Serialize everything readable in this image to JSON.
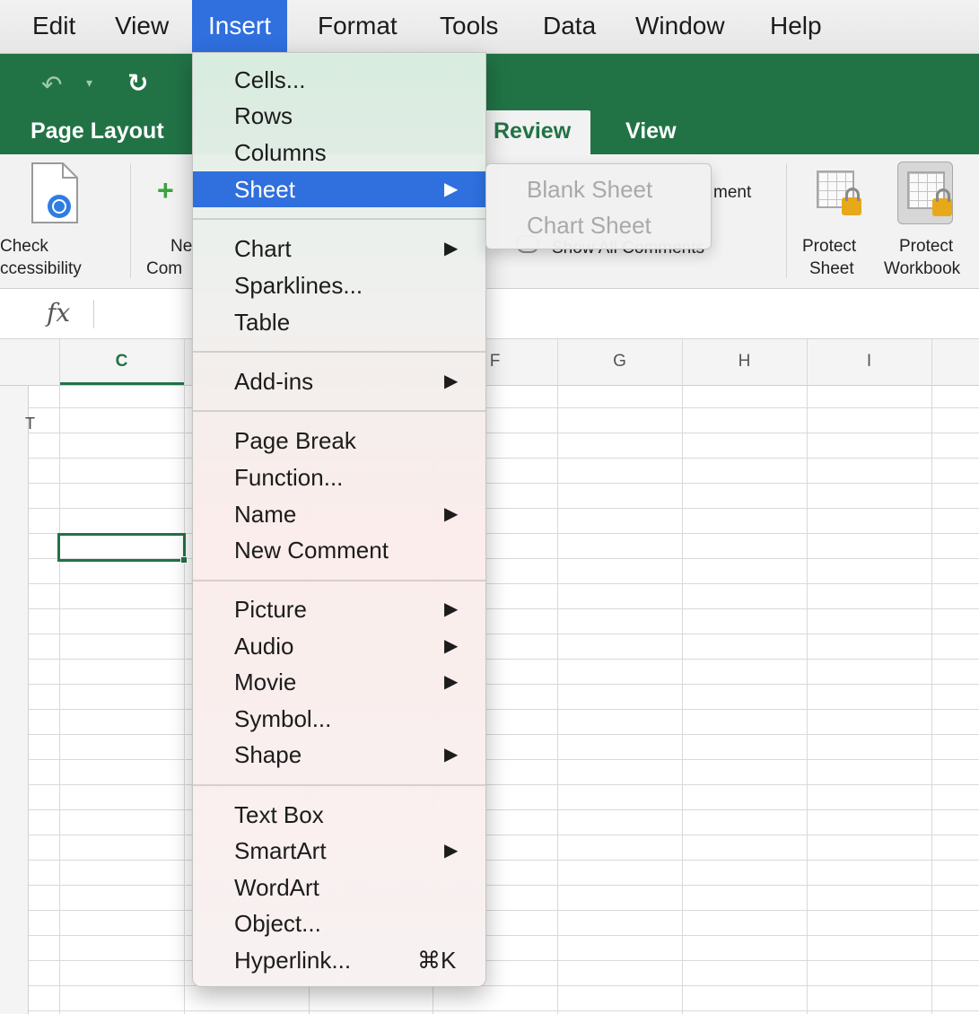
{
  "menubar": {
    "items": [
      {
        "label": "Edit",
        "active": false
      },
      {
        "label": "View",
        "active": false
      },
      {
        "label": "Insert",
        "active": true
      },
      {
        "label": "Format",
        "active": false
      },
      {
        "label": "Tools",
        "active": false
      },
      {
        "label": "Data",
        "active": false
      },
      {
        "label": "Window",
        "active": false
      },
      {
        "label": "Help",
        "active": false
      }
    ]
  },
  "toolbar": {
    "undo_icon": "undo-icon",
    "redo_icon": "redo-icon"
  },
  "tabs": [
    {
      "label": "Page Layout",
      "selected": false
    },
    {
      "label": "Review",
      "selected": true
    },
    {
      "label": "View",
      "selected": false
    }
  ],
  "ribbon": {
    "check_accessibility": [
      "Check",
      "ccessibility"
    ],
    "new_comment": [
      "Ne",
      "Com"
    ],
    "show_all_comments": "Show All Comments",
    "comment_partial": "ment",
    "protect_sheet": [
      "Protect",
      "Sheet"
    ],
    "protect_workbook": [
      "Protect",
      "Workbook"
    ]
  },
  "formula_bar": {
    "fx_label": "fx"
  },
  "sheet": {
    "columns": [
      "C",
      "F",
      "G",
      "H",
      "I"
    ],
    "active_column": "C",
    "row_fragment": "T"
  },
  "insert_menu": {
    "groups": [
      [
        {
          "label": "Cells...",
          "submenu": false
        },
        {
          "label": "Rows",
          "submenu": false
        },
        {
          "label": "Columns",
          "submenu": false
        },
        {
          "label": "Sheet",
          "submenu": true,
          "highlighted": true
        }
      ],
      [
        {
          "label": "Chart",
          "submenu": true
        },
        {
          "label": "Sparklines...",
          "submenu": false
        },
        {
          "label": "Table",
          "submenu": false
        }
      ],
      [
        {
          "label": "Add-ins",
          "submenu": true
        }
      ],
      [
        {
          "label": "Page Break",
          "submenu": false
        },
        {
          "label": "Function...",
          "submenu": false
        },
        {
          "label": "Name",
          "submenu": true
        },
        {
          "label": "New Comment",
          "submenu": false
        }
      ],
      [
        {
          "label": "Picture",
          "submenu": true
        },
        {
          "label": "Audio",
          "submenu": true
        },
        {
          "label": "Movie",
          "submenu": true
        },
        {
          "label": "Symbol...",
          "submenu": false
        },
        {
          "label": "Shape",
          "submenu": true
        }
      ],
      [
        {
          "label": "Text Box",
          "submenu": false
        },
        {
          "label": "SmartArt",
          "submenu": true
        },
        {
          "label": "WordArt",
          "submenu": false
        },
        {
          "label": "Object...",
          "submenu": false
        },
        {
          "label": "Hyperlink...",
          "submenu": false,
          "shortcut": "⌘K"
        }
      ]
    ],
    "arrow_glyph": "▶"
  },
  "sheet_submenu": {
    "items": [
      {
        "label": "Blank Sheet",
        "enabled": false
      },
      {
        "label": "Chart Sheet",
        "enabled": false
      }
    ]
  },
  "colors": {
    "excel_green": "#217346",
    "menu_highlight": "#2f6fde",
    "disabled_text": "#a9a9a9"
  }
}
